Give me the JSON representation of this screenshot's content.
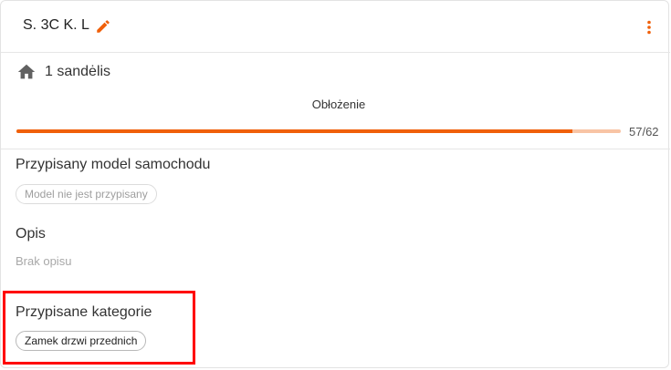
{
  "header": {
    "title": "S. 3C K. L",
    "icons": {
      "edit": "edit-pencil-icon",
      "more": "more-vertical-icon"
    },
    "accent_color": "#f0600a"
  },
  "warehouse": {
    "icon": "home-icon",
    "label": "1 sandėlis"
  },
  "occupancy": {
    "label": "Obłożenie",
    "value": 57,
    "max": 62,
    "text": "57/62"
  },
  "car_model": {
    "title": "Przypisany model samochodu",
    "chip": "Model nie jest przypisany"
  },
  "description": {
    "title": "Opis",
    "text": "Brak opisu"
  },
  "categories": {
    "title": "Przypisane kategorie",
    "items": [
      "Zamek drzwi przednich"
    ]
  }
}
